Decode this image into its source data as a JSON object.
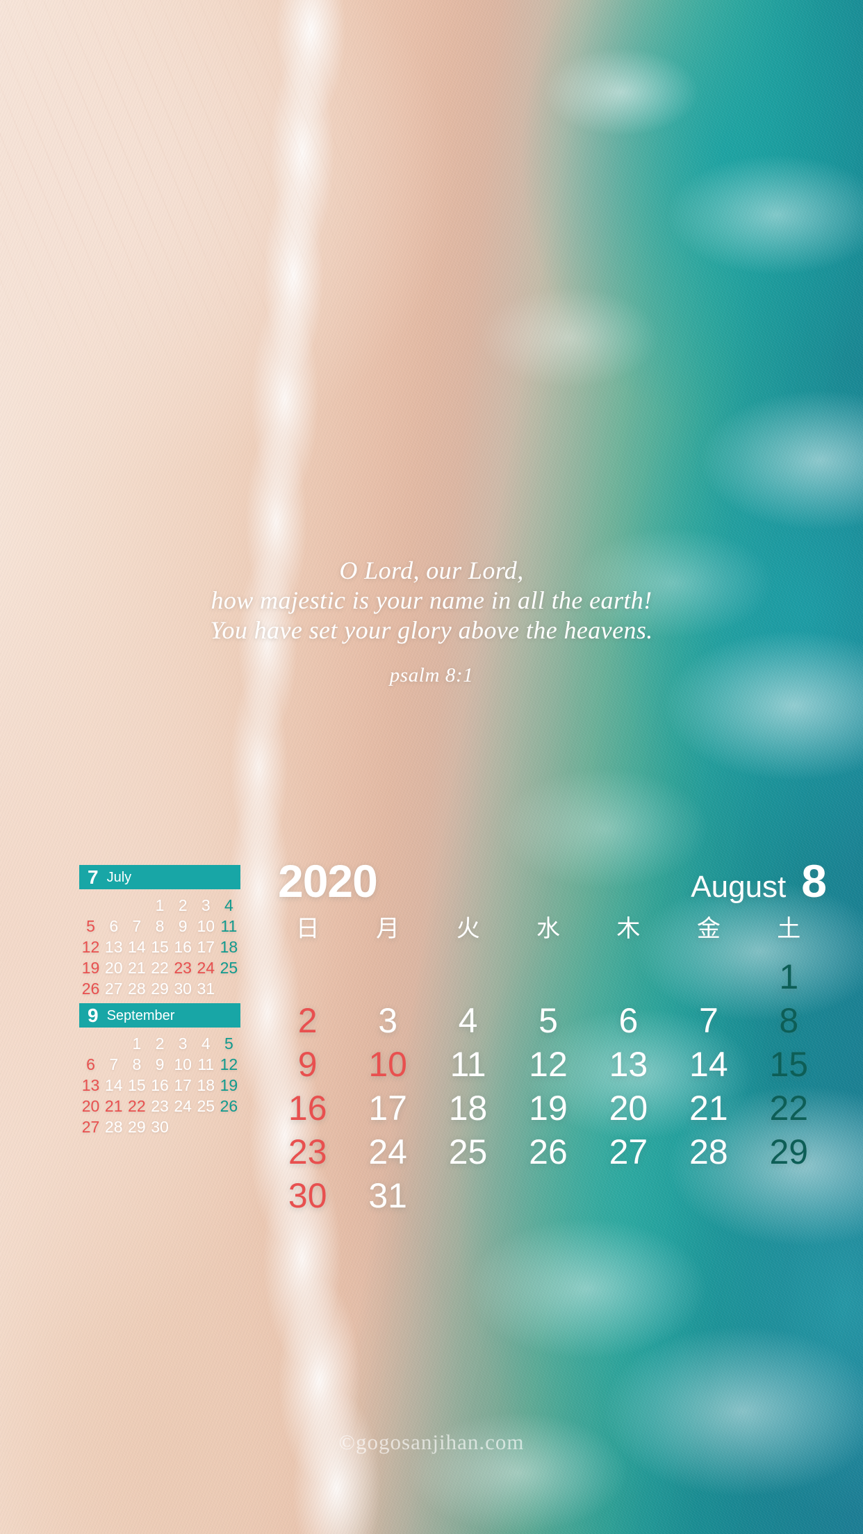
{
  "verse": {
    "lines": [
      "O Lord, our Lord,",
      "how majestic is your name in all the earth!",
      "You have set your glory above the heavens."
    ],
    "reference": "psalm 8:1"
  },
  "main_month": {
    "year": "2020",
    "name": "August",
    "number": "8",
    "weekday_headers": [
      "日",
      "月",
      "火",
      "水",
      "木",
      "金",
      "土"
    ],
    "weeks": [
      [
        {
          "d": "",
          "k": "empty"
        },
        {
          "d": "",
          "k": "empty"
        },
        {
          "d": "",
          "k": "empty"
        },
        {
          "d": "",
          "k": "empty"
        },
        {
          "d": "",
          "k": "empty"
        },
        {
          "d": "",
          "k": "empty"
        },
        {
          "d": "1",
          "k": "sat"
        }
      ],
      [
        {
          "d": "2",
          "k": "sun"
        },
        {
          "d": "3",
          "k": "wd"
        },
        {
          "d": "4",
          "k": "wd"
        },
        {
          "d": "5",
          "k": "wd"
        },
        {
          "d": "6",
          "k": "wd"
        },
        {
          "d": "7",
          "k": "wd"
        },
        {
          "d": "8",
          "k": "sat"
        }
      ],
      [
        {
          "d": "9",
          "k": "sun"
        },
        {
          "d": "10",
          "k": "hol"
        },
        {
          "d": "11",
          "k": "wd"
        },
        {
          "d": "12",
          "k": "wd"
        },
        {
          "d": "13",
          "k": "wd"
        },
        {
          "d": "14",
          "k": "wd"
        },
        {
          "d": "15",
          "k": "sat"
        }
      ],
      [
        {
          "d": "16",
          "k": "sun"
        },
        {
          "d": "17",
          "k": "wd"
        },
        {
          "d": "18",
          "k": "wd"
        },
        {
          "d": "19",
          "k": "wd"
        },
        {
          "d": "20",
          "k": "wd"
        },
        {
          "d": "21",
          "k": "wd"
        },
        {
          "d": "22",
          "k": "sat"
        }
      ],
      [
        {
          "d": "23",
          "k": "sun"
        },
        {
          "d": "24",
          "k": "wd"
        },
        {
          "d": "25",
          "k": "wd"
        },
        {
          "d": "26",
          "k": "wd"
        },
        {
          "d": "27",
          "k": "wd"
        },
        {
          "d": "28",
          "k": "wd"
        },
        {
          "d": "29",
          "k": "sat"
        }
      ],
      [
        {
          "d": "30",
          "k": "sun"
        },
        {
          "d": "31",
          "k": "wd"
        },
        {
          "d": "",
          "k": "empty"
        },
        {
          "d": "",
          "k": "empty"
        },
        {
          "d": "",
          "k": "empty"
        },
        {
          "d": "",
          "k": "empty"
        },
        {
          "d": "",
          "k": "empty"
        }
      ]
    ]
  },
  "mini_months": [
    {
      "number": "7",
      "name": "July",
      "weeks": [
        [
          {
            "d": "",
            "k": "empty"
          },
          {
            "d": "",
            "k": "empty"
          },
          {
            "d": "",
            "k": "empty"
          },
          {
            "d": "1",
            "k": "wd"
          },
          {
            "d": "2",
            "k": "wd"
          },
          {
            "d": "3",
            "k": "wd"
          },
          {
            "d": "4",
            "k": "sat"
          }
        ],
        [
          {
            "d": "5",
            "k": "sun"
          },
          {
            "d": "6",
            "k": "wd"
          },
          {
            "d": "7",
            "k": "wd"
          },
          {
            "d": "8",
            "k": "wd"
          },
          {
            "d": "9",
            "k": "wd"
          },
          {
            "d": "10",
            "k": "wd"
          },
          {
            "d": "11",
            "k": "sat"
          }
        ],
        [
          {
            "d": "12",
            "k": "sun"
          },
          {
            "d": "13",
            "k": "wd"
          },
          {
            "d": "14",
            "k": "wd"
          },
          {
            "d": "15",
            "k": "wd"
          },
          {
            "d": "16",
            "k": "wd"
          },
          {
            "d": "17",
            "k": "wd"
          },
          {
            "d": "18",
            "k": "sat"
          }
        ],
        [
          {
            "d": "19",
            "k": "sun"
          },
          {
            "d": "20",
            "k": "wd"
          },
          {
            "d": "21",
            "k": "wd"
          },
          {
            "d": "22",
            "k": "wd"
          },
          {
            "d": "23",
            "k": "hol"
          },
          {
            "d": "24",
            "k": "hol"
          },
          {
            "d": "25",
            "k": "sat"
          }
        ],
        [
          {
            "d": "26",
            "k": "sun"
          },
          {
            "d": "27",
            "k": "wd"
          },
          {
            "d": "28",
            "k": "wd"
          },
          {
            "d": "29",
            "k": "wd"
          },
          {
            "d": "30",
            "k": "wd"
          },
          {
            "d": "31",
            "k": "wd"
          },
          {
            "d": "",
            "k": "empty"
          }
        ]
      ]
    },
    {
      "number": "9",
      "name": "September",
      "weeks": [
        [
          {
            "d": "",
            "k": "empty"
          },
          {
            "d": "",
            "k": "empty"
          },
          {
            "d": "1",
            "k": "wd"
          },
          {
            "d": "2",
            "k": "wd"
          },
          {
            "d": "3",
            "k": "wd"
          },
          {
            "d": "4",
            "k": "wd"
          },
          {
            "d": "5",
            "k": "sat"
          }
        ],
        [
          {
            "d": "6",
            "k": "sun"
          },
          {
            "d": "7",
            "k": "wd"
          },
          {
            "d": "8",
            "k": "wd"
          },
          {
            "d": "9",
            "k": "wd"
          },
          {
            "d": "10",
            "k": "wd"
          },
          {
            "d": "11",
            "k": "wd"
          },
          {
            "d": "12",
            "k": "sat"
          }
        ],
        [
          {
            "d": "13",
            "k": "sun"
          },
          {
            "d": "14",
            "k": "wd"
          },
          {
            "d": "15",
            "k": "wd"
          },
          {
            "d": "16",
            "k": "wd"
          },
          {
            "d": "17",
            "k": "wd"
          },
          {
            "d": "18",
            "k": "wd"
          },
          {
            "d": "19",
            "k": "sat"
          }
        ],
        [
          {
            "d": "20",
            "k": "sun"
          },
          {
            "d": "21",
            "k": "hol"
          },
          {
            "d": "22",
            "k": "hol"
          },
          {
            "d": "23",
            "k": "wd"
          },
          {
            "d": "24",
            "k": "wd"
          },
          {
            "d": "25",
            "k": "wd"
          },
          {
            "d": "26",
            "k": "sat"
          }
        ],
        [
          {
            "d": "27",
            "k": "sun"
          },
          {
            "d": "28",
            "k": "wd"
          },
          {
            "d": "29",
            "k": "wd"
          },
          {
            "d": "30",
            "k": "wd"
          },
          {
            "d": "",
            "k": "empty"
          },
          {
            "d": "",
            "k": "empty"
          },
          {
            "d": "",
            "k": "empty"
          }
        ]
      ]
    }
  ],
  "watermark": "©gogosanjihan.com",
  "colors": {
    "accent_teal": "#18a6a6",
    "sunday_red": "#e8504f",
    "mini_saturday_teal": "#119a8e",
    "main_saturday_teal": "#0d5e56",
    "text_white": "#ffffff"
  }
}
